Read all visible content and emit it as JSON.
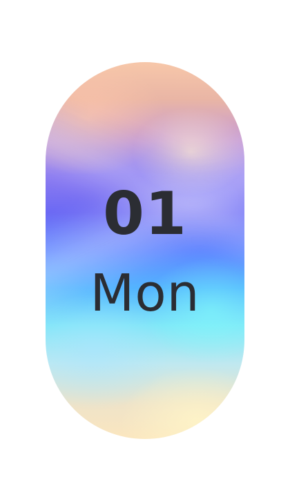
{
  "date_card": {
    "date_number": "01",
    "day_name": "Mon"
  },
  "theme": {
    "text_color": "#2b2d33",
    "gradient_colors": [
      "#f7c7a9",
      "#c59ad7",
      "#6b69f4",
      "#5f86ff",
      "#53b4ff",
      "#80e6f8",
      "#fbe6bf"
    ]
  }
}
